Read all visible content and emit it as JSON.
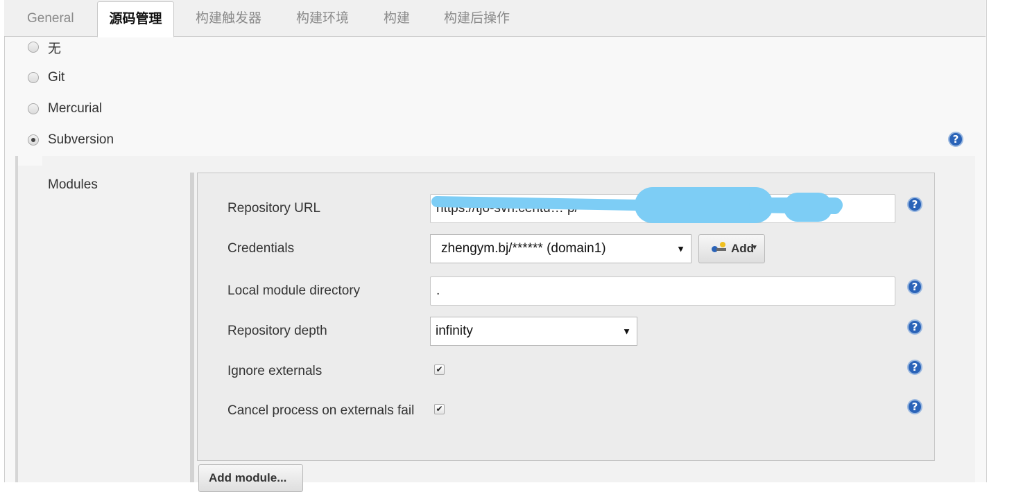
{
  "tabs": [
    "General",
    "源码管理",
    "构建触发器",
    "构建环境",
    "构建",
    "构建后操作"
  ],
  "scm_options": [
    {
      "label": "无",
      "checked": false
    },
    {
      "label": "Git",
      "checked": false
    },
    {
      "label": "Mercurial",
      "checked": false
    },
    {
      "label": "Subversion",
      "checked": true
    }
  ],
  "modules_label": "Modules",
  "module": {
    "repository_url": {
      "label": "Repository URL",
      "value": "https://tjo-svn.centu…                                   p/"
    },
    "credentials": {
      "label": "Credentials",
      "value": "zhengym.bj/****** (domain1)",
      "add_label": "Add"
    },
    "local_module_directory": {
      "label": "Local module directory",
      "value": "."
    },
    "repository_depth": {
      "label": "Repository depth",
      "value": "infinity"
    },
    "ignore_externals": {
      "label": "Ignore externals",
      "checked": true
    },
    "cancel_process": {
      "label": "Cancel process on externals fail",
      "checked": true
    }
  },
  "add_module_label": "Add module...",
  "help_glyph": "?",
  "check_glyph": "✔",
  "caret_glyph": "▼",
  "colors": {
    "help_icon": "#2a63b8",
    "redaction": "#7dcdf5"
  }
}
